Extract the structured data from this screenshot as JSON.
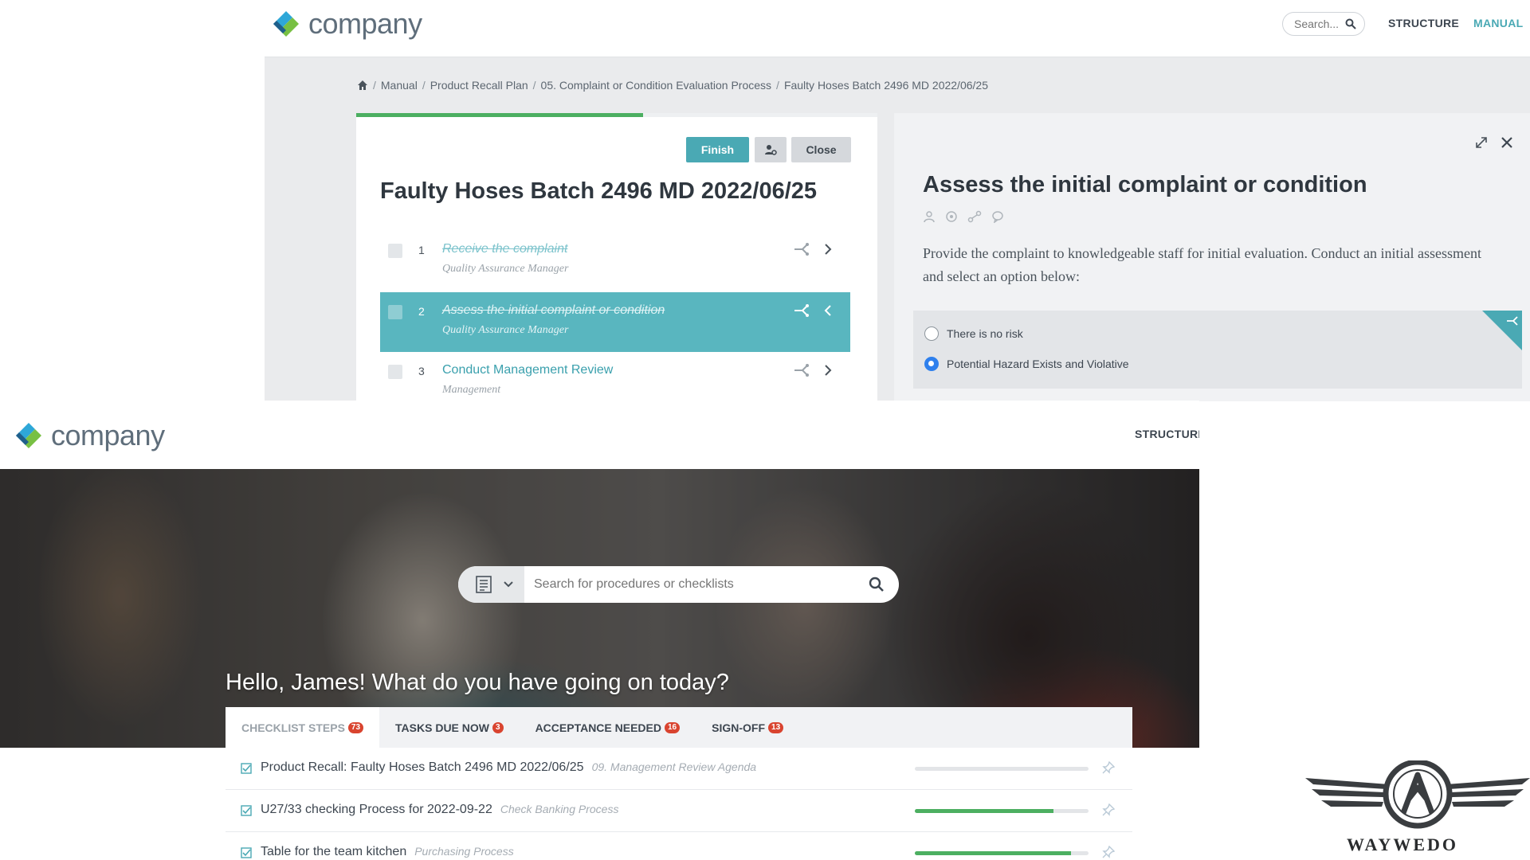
{
  "top_window": {
    "brand": "company",
    "search_placeholder": "Search...",
    "nav": [
      "STRUCTURE",
      "MANUAL"
    ],
    "breadcrumb": [
      "Manual",
      "Product Recall Plan",
      "05. Complaint or Condition Evaluation Process",
      "Faulty Hoses Batch 2496 MD 2022/06/25"
    ],
    "progress_fraction": 0.55,
    "buttons": {
      "finish": "Finish",
      "close": "Close"
    },
    "checklist_title": "Faulty Hoses Batch 2496 MD 2022/06/25",
    "steps": [
      {
        "num": "1",
        "title": "Receive the complaint",
        "role": "Quality Assurance Manager",
        "state": "done"
      },
      {
        "num": "2",
        "title": "Assess the initial complaint or condition",
        "role": "Quality Assurance Manager",
        "state": "active"
      },
      {
        "num": "3",
        "title": "Conduct Management Review",
        "role": "Management",
        "state": "upcoming"
      }
    ],
    "detail": {
      "title": "Assess the initial complaint or condition",
      "description": "Provide the complaint to knowledgeable staff for initial evaluation. Conduct an initial assessment and select an option below:",
      "options": [
        {
          "label": "There is no risk",
          "selected": false
        },
        {
          "label": "Potential Hazard Exists and Violative",
          "selected": true
        }
      ]
    }
  },
  "bottom_window": {
    "brand": "company",
    "nav": [
      "STRUCTURE"
    ],
    "search_placeholder": "Search for procedures or checklists",
    "greeting": "Hello, James! What do you have going on today?",
    "tabs": [
      {
        "label": "CHECKLIST STEPS",
        "count": "73",
        "active": true
      },
      {
        "label": "TASKS DUE NOW",
        "count": "3",
        "active": false
      },
      {
        "label": "ACCEPTANCE NEEDED",
        "count": "16",
        "active": false
      },
      {
        "label": "SIGN-OFF",
        "count": "13",
        "active": false
      }
    ],
    "items": [
      {
        "name": "Product Recall: Faulty Hoses Batch 2496 MD 2022/06/25",
        "process": "09. Management Review Agenda",
        "progress": 0
      },
      {
        "name": "U27/33 checking Process for 2022-09-22",
        "process": "Check Banking Process",
        "progress": 0.8
      },
      {
        "name": "Table for the team kitchen",
        "process": "Purchasing Process",
        "progress": 0.9
      }
    ]
  },
  "watermark": "WAYWEDO",
  "colors": {
    "accent": "#4aa9b4",
    "progress": "#4caf61",
    "badge": "#d9442f",
    "radio": "#2f80ed"
  }
}
